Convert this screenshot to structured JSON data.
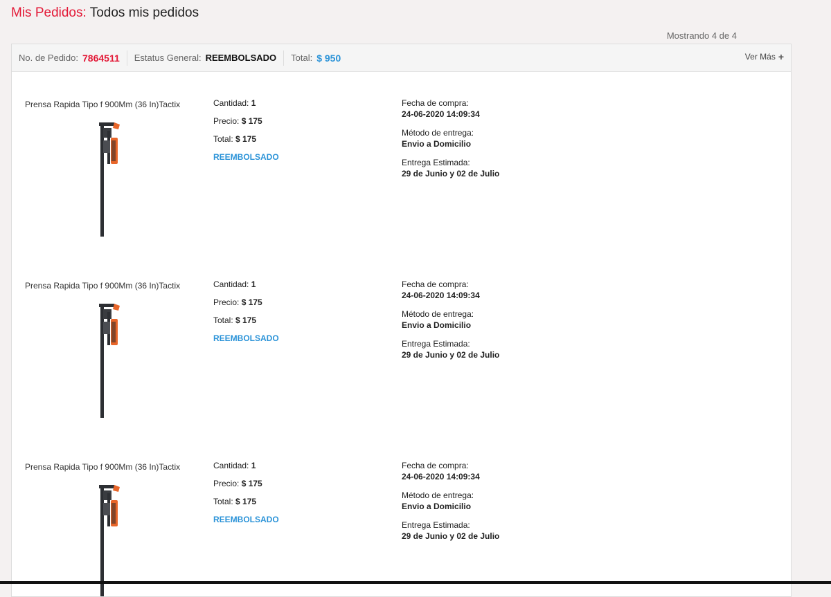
{
  "title": {
    "prefix": "Mis Pedidos:",
    "main": "Todos mis pedidos"
  },
  "showing": "Mostrando 4 de 4",
  "order": {
    "number_label": "No. de Pedido:",
    "number": "7864511",
    "status_label": "Estatus General:",
    "status": "REEMBOLSADO",
    "total_label": "Total:",
    "total": "$ 950",
    "more_label": "Ver Más"
  },
  "items": [
    {
      "name": "Prensa Rapida Tipo f 900Mm (36 In)Tactix",
      "qty_label": "Cantidad:",
      "qty": "1",
      "price_label": "Precio:",
      "price": "$ 175",
      "total_label": "Total:",
      "total": "$ 175",
      "status": "REEMBOLSADO",
      "purchase_label": "Fecha de compra:",
      "purchase": "24-06-2020 14:09:34",
      "delivery_label": "Método de entrega:",
      "delivery": "Envio a Domicilio",
      "eta_label": "Entrega Estimada:",
      "eta": "29 de Junio y 02 de Julio"
    },
    {
      "name": "Prensa Rapida Tipo f 900Mm (36 In)Tactix",
      "qty_label": "Cantidad:",
      "qty": "1",
      "price_label": "Precio:",
      "price": "$ 175",
      "total_label": "Total:",
      "total": "$ 175",
      "status": "REEMBOLSADO",
      "purchase_label": "Fecha de compra:",
      "purchase": "24-06-2020 14:09:34",
      "delivery_label": "Método de entrega:",
      "delivery": "Envio a Domicilio",
      "eta_label": "Entrega Estimada:",
      "eta": "29 de Junio y 02 de Julio"
    },
    {
      "name": "Prensa Rapida Tipo f 900Mm (36 In)Tactix",
      "qty_label": "Cantidad:",
      "qty": "1",
      "price_label": "Precio:",
      "price": "$ 175",
      "total_label": "Total:",
      "total": "$ 175",
      "status": "REEMBOLSADO",
      "purchase_label": "Fecha de compra:",
      "purchase": "24-06-2020 14:09:34",
      "delivery_label": "Método de entrega:",
      "delivery": "Envio a Domicilio",
      "eta_label": "Entrega Estimada:",
      "eta": "29 de Junio y 02 de Julio"
    }
  ],
  "colors": {
    "brand_red": "#e31937",
    "accent_blue": "#2b93d8",
    "clamp_orange": "#e8662a"
  },
  "icons": {
    "more": "plus-icon",
    "product": "bar-clamp-image"
  }
}
